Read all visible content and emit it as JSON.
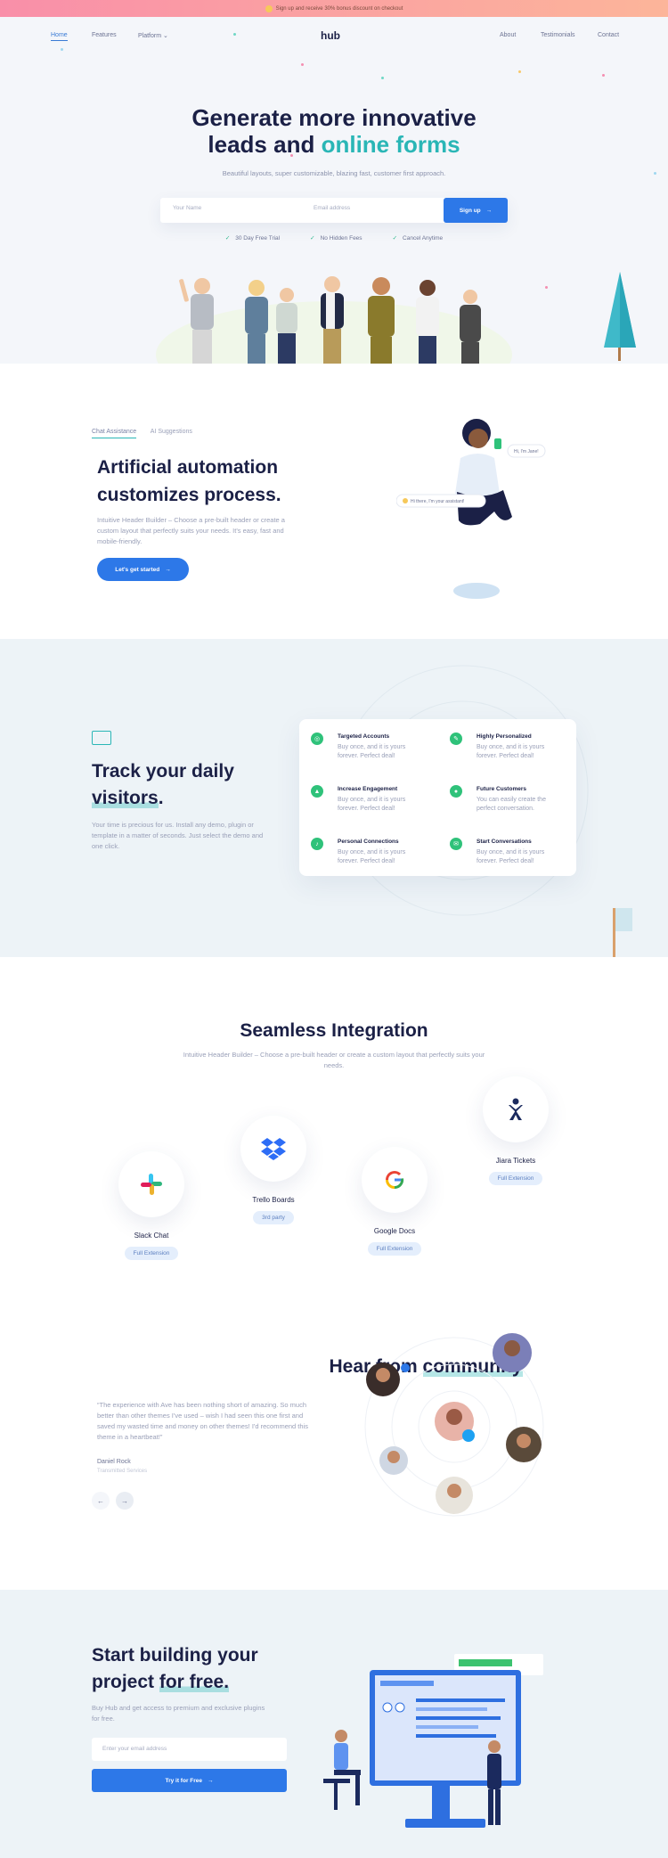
{
  "promo": {
    "text": "Sign up and receive 30% bonus discount on checkout"
  },
  "nav": {
    "logo": "hub",
    "items": [
      "Home",
      "Features",
      "Platform",
      "About",
      "Testimonials",
      "Contact"
    ],
    "platform_caret": "⌄"
  },
  "hero": {
    "title_line1": "Generate more innovative",
    "title_line2_plain": "leads and",
    "title_line2_accent": "online forms",
    "subtitle": "Beautiful layouts, super customizable, blazing fast, customer first approach.",
    "name_placeholder": "Your Name",
    "email_placeholder": "Email address",
    "signup_label": "Sign up",
    "checks": [
      "30 Day Free Trial",
      "No Hidden Fees",
      "Cancel Anytime"
    ]
  },
  "chat": {
    "tabs": [
      "Chat Assistance",
      "AI Suggestions"
    ],
    "title": "Artificial automation customizes process.",
    "body": "Intuitive Header Builder – Choose a pre-built header or create a custom layout that perfectly suits your needs. It's easy, fast and mobile-friendly.",
    "button": "Let's get started",
    "bubble1": "Hi, I'm Jane!",
    "bubble2": "Hi there, I'm your assistant!"
  },
  "track": {
    "title_plain": "Track your daily",
    "title_accent": "visitors",
    "title_end": ".",
    "body": "Your time is precious for us. Install any demo, plugin or template in a matter of seconds. Just select the demo and one click.",
    "features": [
      {
        "title": "Targeted Accounts",
        "desc": "Buy once, and it is yours forever. Perfect deal!"
      },
      {
        "title": "Highly Personalized",
        "desc": "Buy once, and it is yours forever. Perfect deal!"
      },
      {
        "title": "Increase Engagement",
        "desc": "Buy once, and it is yours forever. Perfect deal!"
      },
      {
        "title": "Future Customers",
        "desc": "You can easily create the perfect conversation."
      },
      {
        "title": "Personal Connections",
        "desc": "Buy once, and it is yours forever. Perfect deal!"
      },
      {
        "title": "Start Conversations",
        "desc": "Buy once, and it is yours forever. Perfect deal!"
      }
    ]
  },
  "integration": {
    "title": "Seamless Integration",
    "subtitle": "Intuitive Header Builder – Choose a pre-built header or create a custom layout that perfectly suits your needs.",
    "apps": [
      {
        "name": "Slack Chat",
        "tag": "Full Extension"
      },
      {
        "name": "Trello Boards",
        "tag": "3rd party"
      },
      {
        "name": "Google Docs",
        "tag": "Full Extension"
      },
      {
        "name": "Jiara Tickets",
        "tag": "Full Extension"
      }
    ]
  },
  "community": {
    "title_plain": "Hear from",
    "title_accent": "community",
    "quote": "“The experience with Ave has been nothing short of amazing. So much better than other themes I've used – wish I had seen this one first and saved my wasted time and money on other themes! I'd recommend this theme in a heartbeat!”",
    "author": "Daniel Rock",
    "role": "Transmitted Services",
    "prev": "←",
    "next": "→"
  },
  "cta": {
    "title_line1": "Start building your",
    "title_plain": "project",
    "title_accent": "for free.",
    "body": "Buy Hub and get access to premium and exclusive plugins for free.",
    "email_placeholder": "Enter your email address",
    "button": "Try it for Free"
  },
  "colors": {
    "primary": "#2d78e8",
    "accent": "#2ab6b6",
    "green": "#2fc27a",
    "navy": "#1b2046"
  }
}
